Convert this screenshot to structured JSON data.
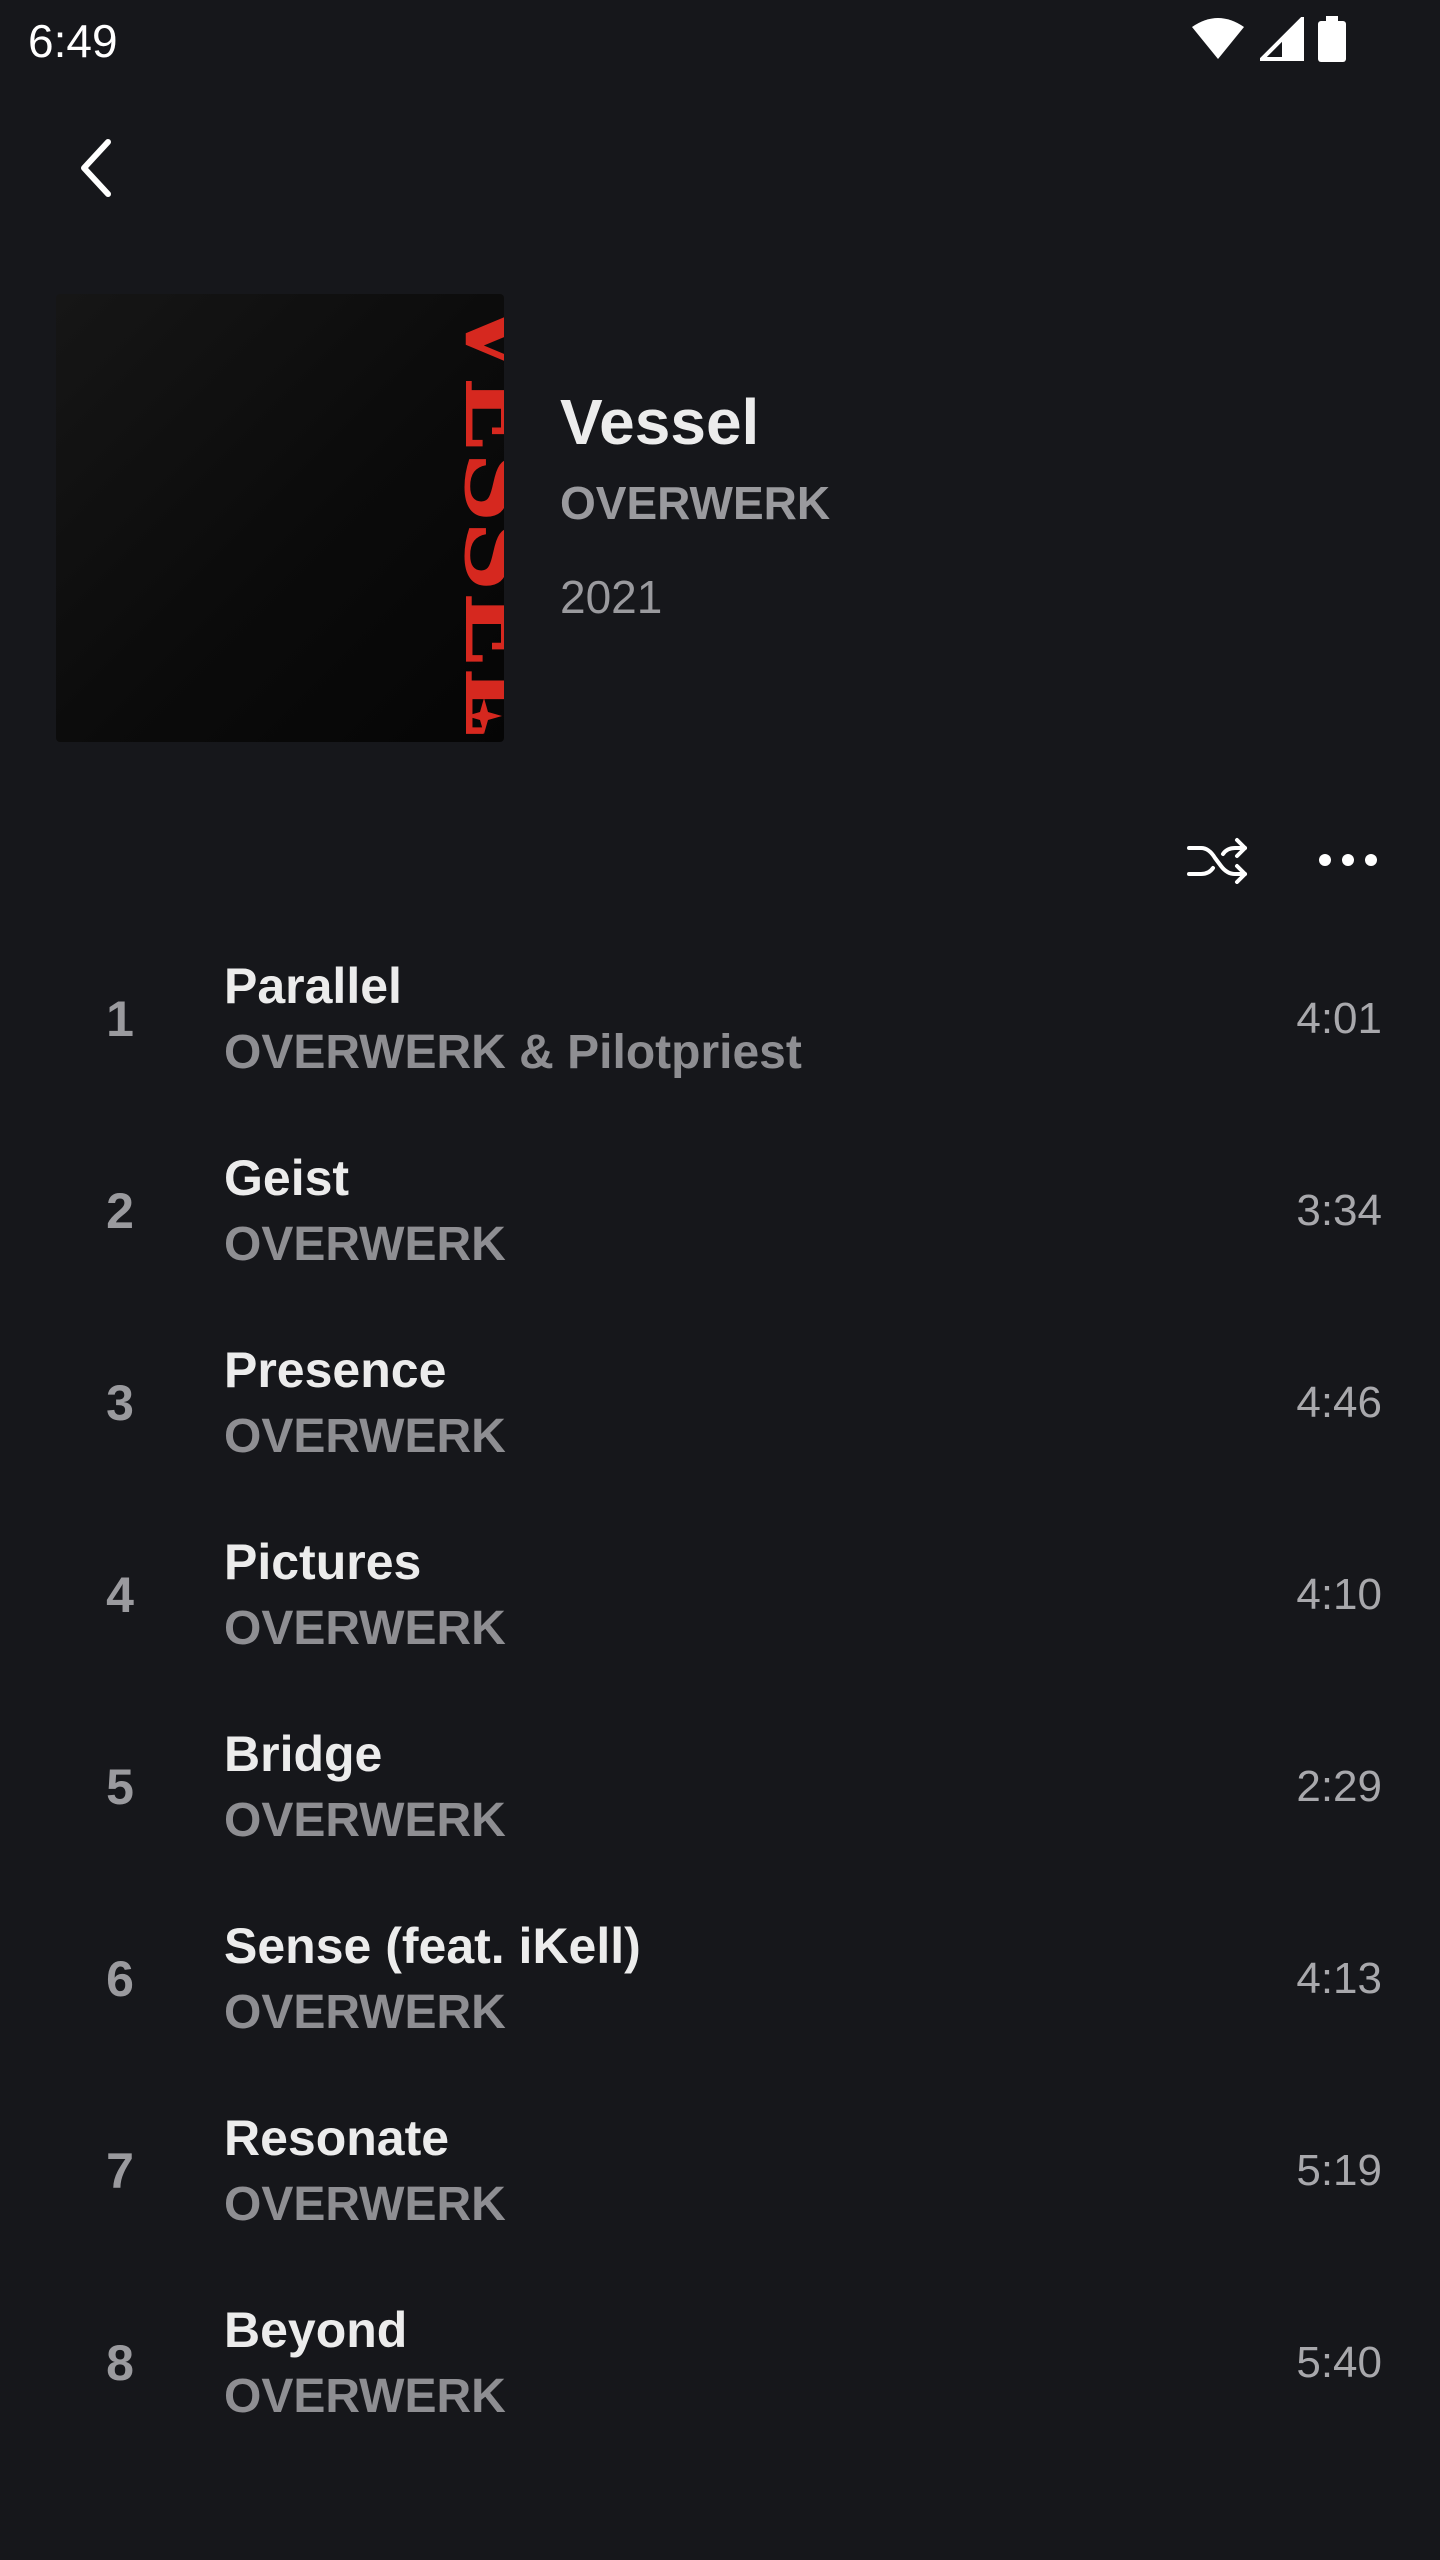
{
  "status_bar": {
    "time": "6:49"
  },
  "album": {
    "cover_text": "VESSEL",
    "title": "Vessel",
    "artist": "OVERWERK",
    "year": "2021"
  },
  "colors": {
    "background": "#16171b",
    "accent_cover_red": "#d6281f",
    "primary_text": "#ececec",
    "secondary_text": "#9a9a9e"
  },
  "tracks": [
    {
      "number": "1",
      "title": "Parallel",
      "artist": "OVERWERK & Pilotpriest",
      "duration": "4:01"
    },
    {
      "number": "2",
      "title": "Geist",
      "artist": "OVERWERK",
      "duration": "3:34"
    },
    {
      "number": "3",
      "title": "Presence",
      "artist": "OVERWERK",
      "duration": "4:46"
    },
    {
      "number": "4",
      "title": "Pictures",
      "artist": "OVERWERK",
      "duration": "4:10"
    },
    {
      "number": "5",
      "title": "Bridge",
      "artist": "OVERWERK",
      "duration": "2:29"
    },
    {
      "number": "6",
      "title": "Sense (feat. iKell)",
      "artist": "OVERWERK",
      "duration": "4:13"
    },
    {
      "number": "7",
      "title": "Resonate",
      "artist": "OVERWERK",
      "duration": "5:19"
    },
    {
      "number": "8",
      "title": "Beyond",
      "artist": "OVERWERK",
      "duration": "5:40"
    }
  ]
}
